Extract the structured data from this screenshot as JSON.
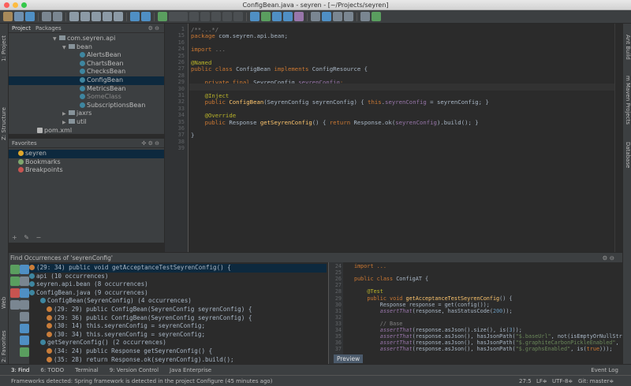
{
  "window": {
    "title": "ConfigBean.java - seyren - [~/Projects/seyren]"
  },
  "project_panel": {
    "tabs": [
      "Project",
      "Packages"
    ],
    "tree": [
      {
        "label": "com.seyren.api",
        "indent": 56,
        "kind": "folder",
        "arrow": "▼"
      },
      {
        "label": "bean",
        "indent": 68,
        "kind": "folder",
        "arrow": "▼"
      },
      {
        "label": "AlertsBean",
        "indent": 90,
        "kind": "class"
      },
      {
        "label": "ChartsBean",
        "indent": 90,
        "kind": "class"
      },
      {
        "label": "ChecksBean",
        "indent": 90,
        "kind": "class"
      },
      {
        "label": "ConfigBean",
        "indent": 90,
        "kind": "class",
        "selected": true
      },
      {
        "label": "MetricsBean",
        "indent": 90,
        "kind": "class"
      },
      {
        "label": "SomeClass",
        "indent": 90,
        "kind": "class",
        "muted": true
      },
      {
        "label": "SubscriptionsBean",
        "indent": 90,
        "kind": "class"
      },
      {
        "label": "jaxrs",
        "indent": 68,
        "kind": "folder",
        "arrow": "▶"
      },
      {
        "label": "util",
        "indent": 68,
        "kind": "folder",
        "arrow": "▶"
      },
      {
        "label": "pom.xml",
        "indent": 36,
        "kind": "file"
      }
    ]
  },
  "favorites_panel": {
    "title": "Favorites",
    "items": [
      {
        "label": "seyren",
        "icon": "star-icon",
        "selected": true
      },
      {
        "label": "Bookmarks",
        "icon": "check-icon"
      },
      {
        "label": "Breakpoints",
        "icon": "breakpoint-icon"
      }
    ]
  },
  "editor": {
    "line_numbers": [
      "1",
      "15",
      "16",
      "24",
      "25",
      "26",
      "27",
      "28",
      "29",
      "30",
      "31",
      "32",
      "33",
      "34",
      "35",
      "36",
      "37",
      "38",
      "39"
    ],
    "lines": [
      [
        {
          "t": "/**...*/",
          "c": "cm"
        }
      ],
      [
        {
          "t": "package ",
          "c": "kw"
        },
        {
          "t": "com.seyren.api.bean;",
          "c": ""
        }
      ],
      [],
      [
        {
          "t": "import ",
          "c": "kw"
        },
        {
          "t": "...",
          "c": "cm"
        }
      ],
      [],
      [
        {
          "t": "@Named",
          "c": "an"
        }
      ],
      [
        {
          "t": "public class ",
          "c": "kw"
        },
        {
          "t": "ConfigBean ",
          "c": ""
        },
        {
          "t": "implements ",
          "c": "kw"
        },
        {
          "t": "ConfigResource {",
          "c": ""
        }
      ],
      [],
      [
        {
          "t": "    private final ",
          "c": "kw"
        },
        {
          "t": "SeyrenConfig ",
          "c": ""
        },
        {
          "t": "seyrenConfig",
          "c": "fld"
        },
        {
          "t": ";",
          "c": "kw"
        }
      ],
      [],
      [
        {
          "t": "    @Inject",
          "c": "an"
        }
      ],
      [
        {
          "t": "    public ",
          "c": "kw"
        },
        {
          "t": "ConfigBean",
          "c": "fn"
        },
        {
          "t": "(SeyrenConfig seyrenConfig) { ",
          "c": ""
        },
        {
          "t": "this",
          "c": "kw"
        },
        {
          "t": ".",
          "c": ""
        },
        {
          "t": "seyrenConfig",
          "c": "fld"
        },
        {
          "t": " = seyrenConfig; }",
          "c": ""
        }
      ],
      [],
      [
        {
          "t": "    @Override",
          "c": "an"
        }
      ],
      [
        {
          "t": "    public ",
          "c": "kw"
        },
        {
          "t": "Response ",
          "c": ""
        },
        {
          "t": "getSeyrenConfig",
          "c": "fn"
        },
        {
          "t": "() { ",
          "c": ""
        },
        {
          "t": "return ",
          "c": "kw"
        },
        {
          "t": "Response.ok(",
          "c": ""
        },
        {
          "t": "seyrenConfig",
          "c": "fld"
        },
        {
          "t": ").build(); }",
          "c": ""
        }
      ],
      [],
      [
        {
          "t": "}",
          "c": ""
        }
      ],
      [],
      []
    ]
  },
  "find_panel": {
    "title": "Find Occurrences of 'seyrenConfig'",
    "rows": [
      {
        "text": "(29: 34) public void getAcceptanceTestSeyrenConfig() {",
        "indent": 0,
        "selected": true
      },
      {
        "text": "api (10 occurrences)",
        "indent": 0
      },
      {
        "text": "seyren.api.bean (8 occurrences)",
        "indent": 0
      },
      {
        "text": "ConfigBean.java (9 occurrences)",
        "indent": 0
      },
      {
        "text": "ConfigBean(SeyrenConfig) (4 occurrences)",
        "indent": 14
      },
      {
        "text": "(29: 29) public ConfigBean(SeyrenConfig seyrenConfig) {",
        "indent": 22
      },
      {
        "text": "(29: 36) public ConfigBean(SeyrenConfig seyrenConfig) {",
        "indent": 22
      },
      {
        "text": "(30: 14) this.seyrenConfig = seyrenConfig;",
        "indent": 22
      },
      {
        "text": "(30: 34) this.seyrenConfig = seyrenConfig;",
        "indent": 22
      },
      {
        "text": "getSeyrenConfig() (2 occurrences)",
        "indent": 14
      },
      {
        "text": "(34: 24) public Response getSeyrenConfig() {",
        "indent": 22
      },
      {
        "text": "(35: 28) return Response.ok(seyrenConfig).build();",
        "indent": 22
      }
    ]
  },
  "preview_panel": {
    "line_numbers": [
      "24",
      "25",
      "26",
      "27",
      "28",
      "29",
      "30",
      "31",
      "32",
      "33",
      "34",
      "35",
      "36",
      "37"
    ],
    "lines": [
      [
        {
          "t": "import ...",
          "c": "kw"
        }
      ],
      [],
      [
        {
          "t": "public class ",
          "c": "kw"
        },
        {
          "t": "ConfigAT {",
          "c": ""
        }
      ],
      [],
      [
        {
          "t": "    @Test",
          "c": "an"
        }
      ],
      [
        {
          "t": "    public void ",
          "c": "kw"
        },
        {
          "t": "getAcceptanceTestSeyrenConfig",
          "c": "fn"
        },
        {
          "t": "() {",
          "c": ""
        }
      ],
      [
        {
          "t": "        Response response = get(config());",
          "c": ""
        }
      ],
      [
        {
          "t": "        ",
          "c": ""
        },
        {
          "t": "assertThat",
          "c": "fi"
        },
        {
          "t": "(response, hasStatusCode(",
          "c": ""
        },
        {
          "t": "200",
          "c": "nm"
        },
        {
          "t": "));",
          "c": ""
        }
      ],
      [],
      [
        {
          "t": "        // Base",
          "c": "cm"
        }
      ],
      [
        {
          "t": "        ",
          "c": ""
        },
        {
          "t": "assertThat",
          "c": "fi"
        },
        {
          "t": "(response.asJson().size(), is(",
          "c": ""
        },
        {
          "t": "3",
          "c": "nm"
        },
        {
          "t": "));",
          "c": ""
        }
      ],
      [
        {
          "t": "        ",
          "c": ""
        },
        {
          "t": "assertThat",
          "c": "fi"
        },
        {
          "t": "(response.asJson(), hasJsonPath(",
          "c": ""
        },
        {
          "t": "\"$.baseUrl\"",
          "c": "st"
        },
        {
          "t": ", not(isEmptyOrNullString())))",
          "c": ""
        }
      ],
      [
        {
          "t": "        ",
          "c": ""
        },
        {
          "t": "assertThat",
          "c": "fi"
        },
        {
          "t": "(response.asJson(), hasJsonPath(",
          "c": ""
        },
        {
          "t": "\"$.graphiteCarbonPickleEnabled\"",
          "c": "st"
        },
        {
          "t": ", is(",
          "c": ""
        },
        {
          "t": "false",
          "c": "kw"
        }
      ],
      [
        {
          "t": "        ",
          "c": ""
        },
        {
          "t": "assertThat",
          "c": "fi"
        },
        {
          "t": "(response.asJson(), hasJsonPath(",
          "c": ""
        },
        {
          "t": "\"$.graphsEnabled\"",
          "c": "st"
        },
        {
          "t": ", is(",
          "c": ""
        },
        {
          "t": "true",
          "c": "kw"
        },
        {
          "t": ")));",
          "c": ""
        }
      ]
    ],
    "tab": "Preview"
  },
  "sidebars": {
    "left_top": [
      "1: Project",
      "Z: Structure"
    ],
    "left_bottom": [
      "Web",
      "2: Favorites"
    ],
    "right": [
      "Ant Build",
      "m Maven Projects",
      "Database"
    ]
  },
  "bottom_tabs": [
    "3: Find",
    "6: TODO",
    "Terminal",
    "9: Version Control",
    "Java Enterprise"
  ],
  "event_log": "Event Log",
  "status": {
    "message": "Frameworks detected: Spring framework is detected in the project Configure (45 minutes ago)",
    "position": "27:5",
    "line_sep": "LF≑",
    "encoding": "UTF-8≑",
    "git": "Git: master≑"
  },
  "colors": {
    "selection": "#0d293e",
    "keyword": "#cc7832",
    "annotation": "#bbb529",
    "method": "#ffc66d",
    "field": "#9876aa"
  }
}
